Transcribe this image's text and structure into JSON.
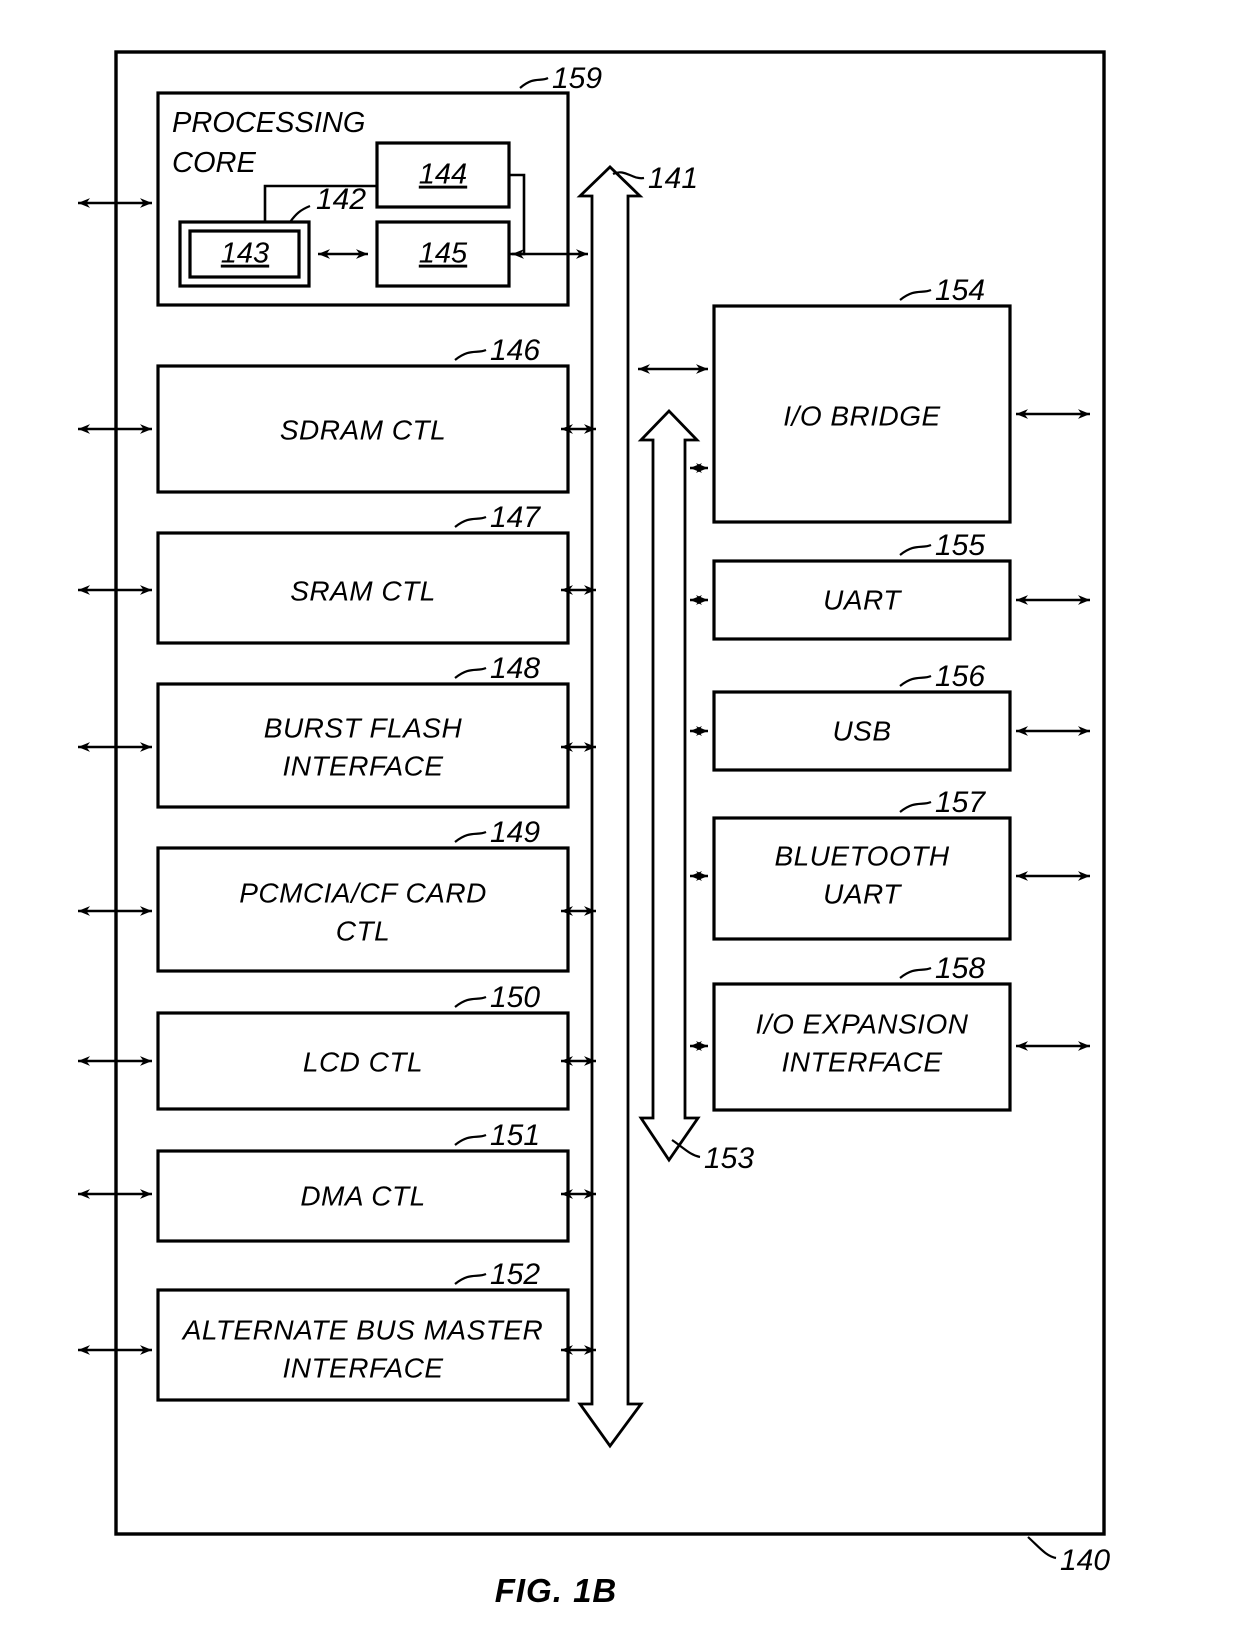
{
  "figure": {
    "caption": "FIG. 1B",
    "outer_ref": "140",
    "core": {
      "title_line1": "PROCESSING",
      "title_line2": "CORE",
      "ref": "159",
      "inner_blocks": [
        {
          "ref": "142",
          "kind": "outer-wrapper"
        },
        {
          "ref": "143",
          "kind": "inner-block"
        },
        {
          "ref": "144",
          "kind": "block"
        },
        {
          "ref": "145",
          "kind": "block"
        }
      ]
    },
    "bus": {
      "main_ref": "141",
      "secondary_ref": "153"
    },
    "left_blocks": [
      {
        "ref": "146",
        "label": "SDRAM CTL",
        "lines": [
          "SDRAM CTL"
        ]
      },
      {
        "ref": "147",
        "label": "SRAM CTL",
        "lines": [
          "SRAM CTL"
        ]
      },
      {
        "ref": "148",
        "label": "BURST FLASH INTERFACE",
        "lines": [
          "BURST FLASH",
          "INTERFACE"
        ]
      },
      {
        "ref": "149",
        "label": "PCMCIA/CF CARD CTL",
        "lines": [
          "PCMCIA/CF CARD",
          "CTL"
        ]
      },
      {
        "ref": "150",
        "label": "LCD CTL",
        "lines": [
          "LCD CTL"
        ]
      },
      {
        "ref": "151",
        "label": "DMA CTL",
        "lines": [
          "DMA CTL"
        ]
      },
      {
        "ref": "152",
        "label": "ALTERNATE BUS MASTER INTERFACE",
        "lines": [
          "ALTERNATE BUS MASTER",
          "INTERFACE"
        ]
      }
    ],
    "right_blocks": [
      {
        "ref": "154",
        "label": "I/O BRIDGE",
        "lines": [
          "I/O BRIDGE"
        ]
      },
      {
        "ref": "155",
        "label": "UART",
        "lines": [
          "UART"
        ]
      },
      {
        "ref": "156",
        "label": "USB",
        "lines": [
          "USB"
        ]
      },
      {
        "ref": "157",
        "label": "BLUETOOTH UART",
        "lines": [
          "BLUETOOTH",
          "UART"
        ]
      },
      {
        "ref": "158",
        "label": "I/O EXPANSION INTERFACE",
        "lines": [
          "I/O EXPANSION",
          "INTERFACE"
        ]
      }
    ]
  }
}
